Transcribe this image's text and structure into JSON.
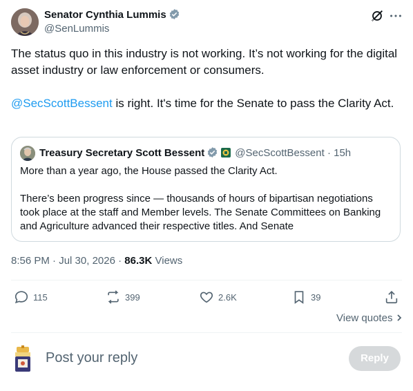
{
  "author": {
    "name": "Senator Cynthia Lummis",
    "handle": "@SenLummis"
  },
  "tweet": {
    "paragraph1": "The status quo in this industry is not working. It’s not working for the digital asset industry or law enforcement or consumers.",
    "mention": "@SecScottBessent",
    "paragraph2_rest": " is right. It's time for the Senate to pass the Clarity Act."
  },
  "quote": {
    "name": "Treasury Secretary Scott Bessent",
    "handle": "@SecScottBessent",
    "time_sep": "·",
    "time": "15h",
    "paragraph1": "More than a year ago, the House passed the Clarity Act.",
    "paragraph2": "There’s been progress since — thousands of hours of bipartisan negotiations took place at the staff and Member levels. The Senate Committees on Banking and Agriculture advanced their respective titles. And Senate"
  },
  "meta": {
    "time": "8:56 PM",
    "sep1": "·",
    "date": "Jul 30, 2026",
    "sep2": "·",
    "views_count": "86.3K",
    "views_label": "Views"
  },
  "actions": {
    "replies": "115",
    "reposts": "399",
    "likes": "2.6K",
    "bookmarks": "39"
  },
  "view_quotes": "View quotes",
  "reply": {
    "placeholder": "Post your reply",
    "button": "Reply"
  },
  "colors": {
    "accent": "#1d9bf0",
    "secondary_text": "#536471",
    "verified": "#829aab"
  }
}
